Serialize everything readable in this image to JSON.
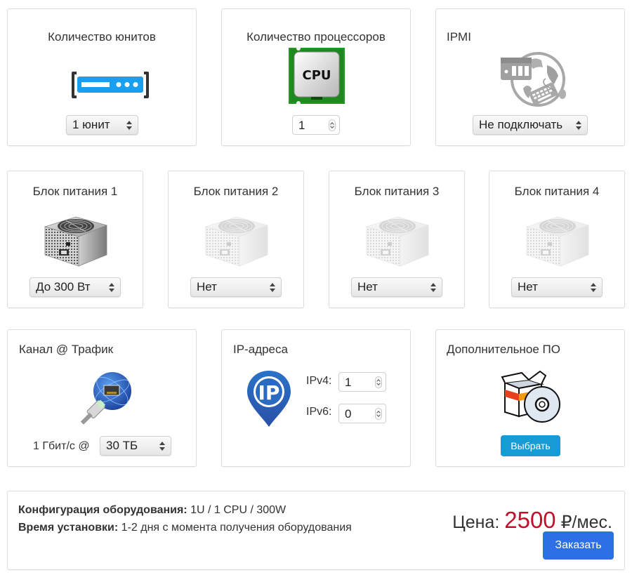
{
  "cards": {
    "units": {
      "title": "Количество юнитов",
      "icon": "rack-server-icon",
      "select_value": "1 юнит"
    },
    "cpu": {
      "title": "Количество процессоров",
      "icon": "cpu-chip-icon",
      "icon_text": "CPU",
      "value": "1"
    },
    "ipmi": {
      "title": "IPMI",
      "icon": "remote-management-globe-icon",
      "select_value": "Не подключать"
    },
    "psu": [
      {
        "title": "Блок питания 1",
        "select_value": "До 300 Вт",
        "active": true
      },
      {
        "title": "Блок питания 2",
        "select_value": "Нет",
        "active": false
      },
      {
        "title": "Блок питания 3",
        "select_value": "Нет",
        "active": false
      },
      {
        "title": "Блок питания 4",
        "select_value": "Нет",
        "active": false
      }
    ],
    "channel": {
      "title": "Канал @ Трафик",
      "icon": "network-globe-ethernet-icon",
      "speed_label": "1 Гбит/с @",
      "select_value": "30 ТБ"
    },
    "ip": {
      "title": "IP-адреса",
      "icon": "ip-location-pin-icon",
      "icon_text": "IP",
      "ipv4_label": "IPv4:",
      "ipv4_value": "1",
      "ipv6_label": "IPv6:",
      "ipv6_value": "0"
    },
    "software": {
      "title": "Дополнительное ПО",
      "icon": "software-box-disc-icon",
      "button_label": "Выбрать"
    }
  },
  "summary": {
    "config_label": "Конфигурация оборудования:",
    "config_value": "1U / 1 CPU / 300W",
    "install_label": "Время установки:",
    "install_value": "1-2 дня с момента получения оборудования",
    "price_label": "Цена:",
    "price_amount": "2500",
    "price_unit": "₽/мес.",
    "order_button": "Заказать"
  },
  "colors": {
    "price_accent": "#c0102b",
    "order_button": "#2f6fe6",
    "select_button": "#169bd5",
    "server_icon": "#1a9ff0"
  }
}
